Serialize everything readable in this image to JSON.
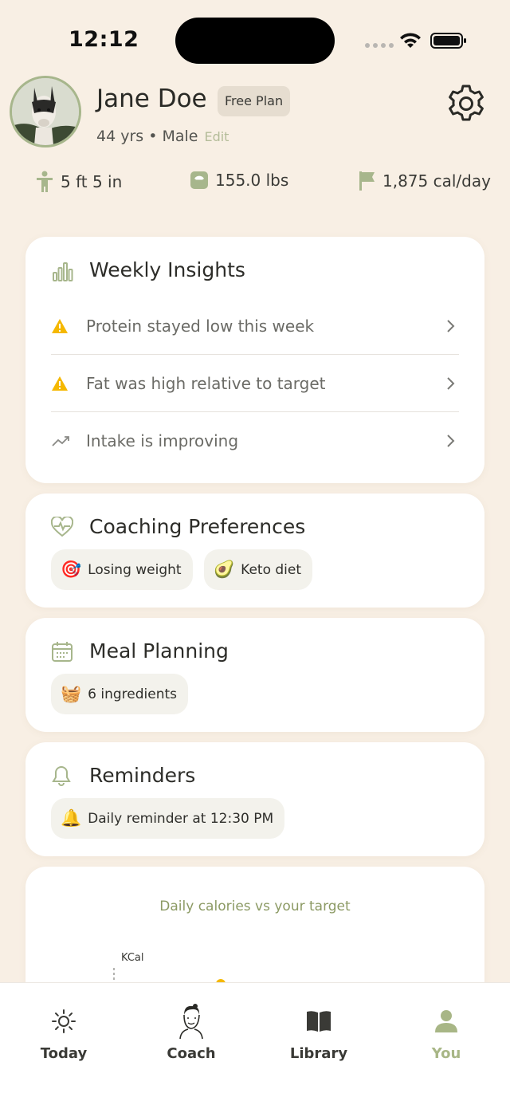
{
  "status_bar": {
    "time": "12:12"
  },
  "profile": {
    "name": "Jane Doe",
    "plan_badge": "Free Plan",
    "meta": "44 yrs • Male",
    "edit_label": "Edit",
    "stats": {
      "height": "5 ft 5 in",
      "weight": "155.0 lbs",
      "calories": "1,875 cal/day"
    }
  },
  "weekly_insights": {
    "title": "Weekly Insights",
    "items": [
      {
        "icon": "warning-icon",
        "label": "Protein stayed low this week"
      },
      {
        "icon": "warning-icon",
        "label": "Fat was high relative to target"
      },
      {
        "icon": "trend-up-icon",
        "label": "Intake is improving"
      }
    ]
  },
  "coaching_preferences": {
    "title": "Coaching Preferences",
    "chips": [
      {
        "emoji": "🎯",
        "label": "Losing weight"
      },
      {
        "emoji": "🥑",
        "label": "Keto diet"
      }
    ]
  },
  "meal_planning": {
    "title": "Meal Planning",
    "chips": [
      {
        "emoji": "🧺",
        "label": "6 ingredients"
      }
    ]
  },
  "reminders": {
    "title": "Reminders",
    "chips": [
      {
        "emoji": "🔔",
        "label": "Daily reminder at 12:30 PM"
      }
    ]
  },
  "calorie_chart": {
    "caption": "Daily calories vs your target",
    "ylabel": "KCal"
  },
  "tab_bar": {
    "tabs": [
      {
        "label": "Today",
        "icon": "sun-icon"
      },
      {
        "label": "Coach",
        "icon": "coach-avatar-icon"
      },
      {
        "label": "Library",
        "icon": "book-icon"
      },
      {
        "label": "You",
        "icon": "person-icon",
        "active": true
      }
    ]
  },
  "colors": {
    "background": "#f8efe4",
    "accent_green": "#a8b686",
    "warning": "#f5b800",
    "card": "#ffffff"
  }
}
